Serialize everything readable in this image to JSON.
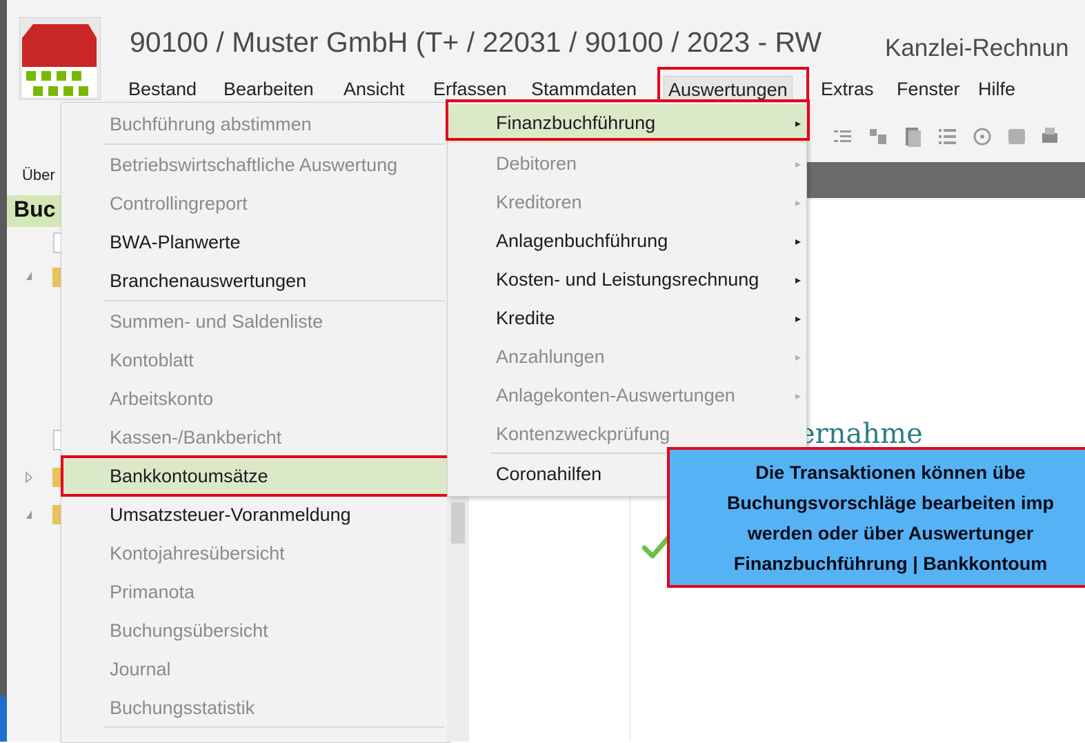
{
  "window": {
    "title": "90100 / Muster GmbH (T+ / 22031 / 90100 / 2023 - RW",
    "subtitle": "Kanzlei-Rechnun"
  },
  "menubar": {
    "items": [
      "Bestand",
      "Bearbeiten",
      "Ansicht",
      "Erfassen",
      "Stammdaten",
      "Auswertungen",
      "Extras",
      "Fenster",
      "Hilfe"
    ],
    "active": "Auswertungen"
  },
  "tree": {
    "top_label": "Über",
    "header": "Buc"
  },
  "dropdown_main": {
    "items": [
      {
        "label": "Buchführung abstimmen",
        "state": "disabled"
      },
      {
        "label": "Betriebswirtschaftliche Auswertung",
        "state": "disabled"
      },
      {
        "label": "Controllingreport",
        "state": "disabled"
      },
      {
        "label": "BWA-Planwerte",
        "state": "enabled"
      },
      {
        "label": "Branchenauswertungen",
        "state": "enabled"
      },
      {
        "label": "Summen- und Saldenliste",
        "state": "disabled"
      },
      {
        "label": "Kontoblatt",
        "state": "disabled"
      },
      {
        "label": "Arbeitskonto",
        "state": "disabled"
      },
      {
        "label": "Kassen-/Bankbericht",
        "state": "disabled"
      },
      {
        "label": "Bankkontoumsätze",
        "state": "selected"
      },
      {
        "label": "Umsatzsteuer-Voranmeldung",
        "state": "enabled"
      },
      {
        "label": "Kontojahresübersicht",
        "state": "disabled"
      },
      {
        "label": "Primanota",
        "state": "disabled"
      },
      {
        "label": "Buchungsübersicht",
        "state": "disabled"
      },
      {
        "label": "Journal",
        "state": "disabled"
      },
      {
        "label": "Buchungsstatistik",
        "state": "disabled"
      }
    ]
  },
  "dropdown_sub": {
    "items": [
      {
        "label": "Finanzbuchführung",
        "state": "selected",
        "submenu": true
      },
      {
        "label": "Debitoren",
        "state": "disabled",
        "submenu": true
      },
      {
        "label": "Kreditoren",
        "state": "disabled",
        "submenu": true
      },
      {
        "label": "Anlagenbuchführung",
        "state": "enabled",
        "submenu": true
      },
      {
        "label": "Kosten- und Leistungsrechnung",
        "state": "enabled",
        "submenu": true
      },
      {
        "label": "Kredite",
        "state": "enabled",
        "submenu": true
      },
      {
        "label": "Anzahlungen",
        "state": "disabled",
        "submenu": true
      },
      {
        "label": "Anlagekonten-Auswertungen",
        "state": "disabled",
        "submenu": true
      },
      {
        "label": "Kontenzweckprüfung",
        "state": "disabled",
        "submenu": false
      },
      {
        "label": "Coronahilfen",
        "state": "enabled",
        "submenu": false
      }
    ]
  },
  "content": {
    "heading_fragment": "ernahme"
  },
  "callout": {
    "lines": [
      "Die Transaktionen können übe",
      "Buchungsvorschläge bearbeiten imp",
      "werden oder über Auswertunger",
      "Finanzbuchführung | Bankkontoum"
    ]
  },
  "colors": {
    "highlight_border": "#e3001b",
    "selected_bg": "#dce9c9",
    "callout_bg": "#55b3f5",
    "tree_header_bg": "#d3e7b8",
    "accent_teal": "#2b7d86"
  },
  "icons": [
    "app-logo-icon",
    "toolbar-icons",
    "document-icon",
    "folder-icon",
    "expand-icon",
    "checkmark-icon",
    "submenu-arrow-icon"
  ]
}
